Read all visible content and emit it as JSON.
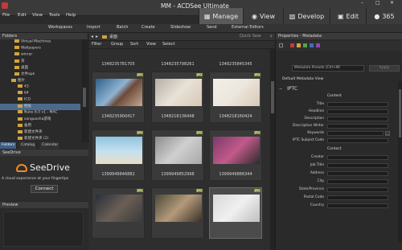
{
  "window": {
    "title": "MM - ACDSee Ultimate",
    "controls": {
      "minimize": "–",
      "maximize": "□",
      "close": "✕"
    }
  },
  "menu": [
    "File",
    "Edit",
    "View",
    "Tools",
    "Help"
  ],
  "modes": [
    {
      "label": "Manage",
      "icon": "▦",
      "active": true
    },
    {
      "label": "View",
      "icon": "◉",
      "active": false
    },
    {
      "label": "Develop",
      "icon": "▧",
      "active": false
    },
    {
      "label": "Edit",
      "icon": "▣",
      "active": false
    },
    {
      "label": "365",
      "icon": "●",
      "active": false
    }
  ],
  "toolbar": [
    "Workspaces",
    "Import",
    "Batch",
    "Create",
    "Slideshow",
    "Send",
    "External Editors"
  ],
  "folders": {
    "title": "Folders",
    "items": [
      {
        "label": "Virtual Machines",
        "sel": false
      },
      {
        "label": "Wallpapers",
        "sel": false
      },
      {
        "label": "winrar",
        "sel": false
      },
      {
        "label": "资",
        "sel": false
      },
      {
        "label": "桌面",
        "sel": false
      },
      {
        "label": "文件apk",
        "sel": false
      },
      {
        "label": "图片",
        "sel": false
      },
      {
        "label": "43",
        "sel": false
      },
      {
        "label": "64",
        "sel": false
      },
      {
        "label": "ICO",
        "sel": false
      },
      {
        "label": "壁纸",
        "sel": true
      },
      {
        "label": "Nuke 8.0 v1 - MAC",
        "sel": false
      },
      {
        "label": "sanguosha游戏",
        "sel": false
      },
      {
        "label": "备用",
        "sel": false
      },
      {
        "label": "新建文件夹",
        "sel": false
      },
      {
        "label": "新建文件夹 (2)",
        "sel": false
      }
    ],
    "tabs": [
      "Folders",
      "Catalog",
      "Calendar"
    ]
  },
  "seedrive": {
    "title": "SeeDrive",
    "name": "SeeDrive",
    "tagline": "A cloud experience at your fingertips",
    "button": "Connect"
  },
  "preview": {
    "title": "Preview"
  },
  "browser": {
    "path": "桌面",
    "search_placeholder": "Quick Sear",
    "filters": [
      "Filter",
      "Group",
      "Sort",
      "View",
      "Select"
    ],
    "top_captions": [
      "1348235781705",
      "1348235798261",
      "1348235845345"
    ],
    "badge": "JPG",
    "thumbs": [
      {
        "caption": "1348235900417",
        "ph": "linear-gradient(135deg,#2f5f8a,#8fb3d1 45%,#6d4a3a 60%,#c2a78f)"
      },
      {
        "caption": "1348218136448",
        "ph": "linear-gradient(135deg,#b5b0a6,#e7e1d6 50%,#d9c7b3)"
      },
      {
        "caption": "1348218160424",
        "ph": "linear-gradient(135deg,#f2efe9,#ece6dd 50%,#d8c9b6)"
      },
      {
        "caption": "1399949846882",
        "ph": "linear-gradient(180deg,#8fc3df,#c5e1ef 55%,#e9dcc3)"
      },
      {
        "caption": "1399949852998",
        "ph": "linear-gradient(135deg,#8c8c8c,#cfcfcf 50%,#a8a8a8)"
      },
      {
        "caption": "1399949886344",
        "ph": "linear-gradient(135deg,#7a3a6a,#c25a8a 50%,#2a2a2a)"
      },
      {
        "caption": "",
        "ph": "linear-gradient(135deg,#2a2f3a,#6a5f55 50%,#3a3a3a)"
      },
      {
        "caption": "",
        "ph": "linear-gradient(135deg,#4a4a3a,#b49a7a 50%,#3a3028)"
      },
      {
        "caption": "",
        "ph": "linear-gradient(135deg,#d8d8d8,#f0f0f0 50%,#bfbfbf)"
      }
    ]
  },
  "properties": {
    "title": "Properties - Metadata",
    "preset": "Metadata Presets (Ctrl+M)",
    "apply": "Apply",
    "view": "Default Metadata View",
    "section": "IPTC",
    "groups": [
      {
        "header": "Content",
        "fields": [
          "Title",
          "Headline",
          "Description",
          "Description Writer",
          "Keywords",
          "IPTC Subject Code"
        ]
      },
      {
        "header": "Contact",
        "fields": [
          "Creator",
          "Job Title",
          "Address",
          "City",
          "State/Province",
          "Postal Code",
          "Country"
        ]
      }
    ]
  }
}
